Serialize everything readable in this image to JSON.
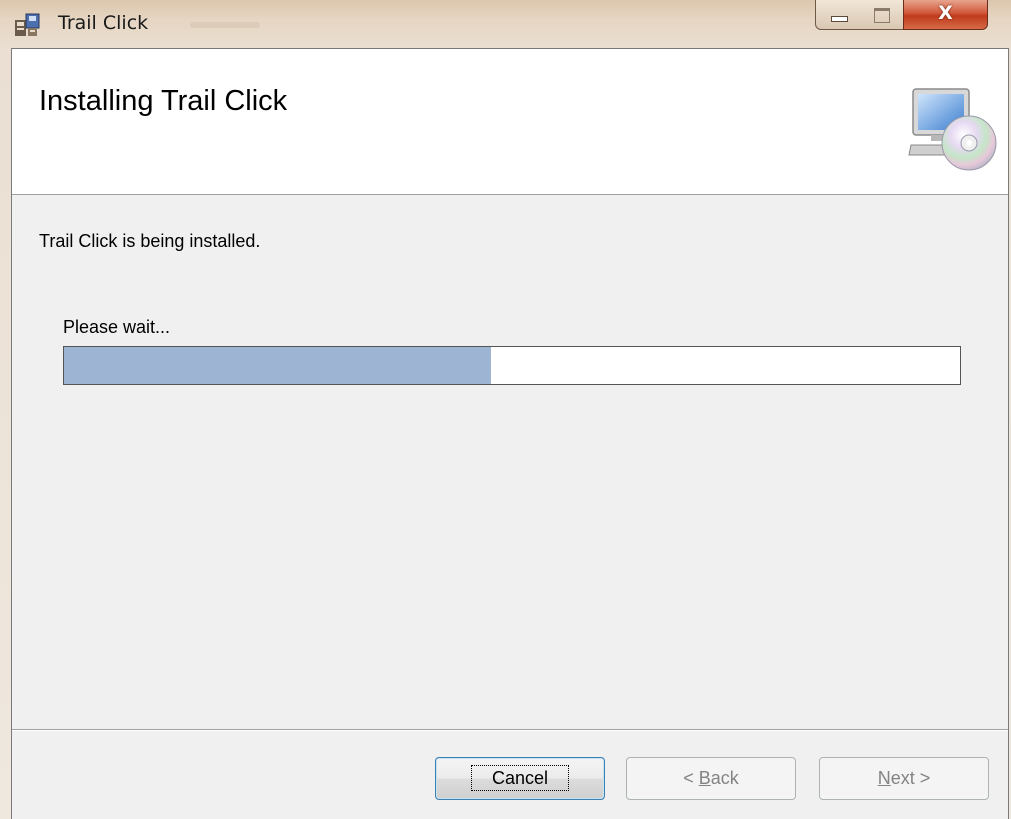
{
  "window": {
    "title": "Trail Click"
  },
  "banner": {
    "title": "Installing Trail Click",
    "icon": "computer-cd-icon"
  },
  "content": {
    "status": "Trail Click is being installed.",
    "wait_label": "Please wait...",
    "progress_fraction": 0.477
  },
  "buttons": {
    "cancel": "Cancel",
    "back_arrow": "< ",
    "back_key": "B",
    "back_rest": "ack",
    "next_key": "N",
    "next_rest": "ext >"
  },
  "colors": {
    "progress_fill": "#9db5d2",
    "close_button": "#c8482a"
  }
}
